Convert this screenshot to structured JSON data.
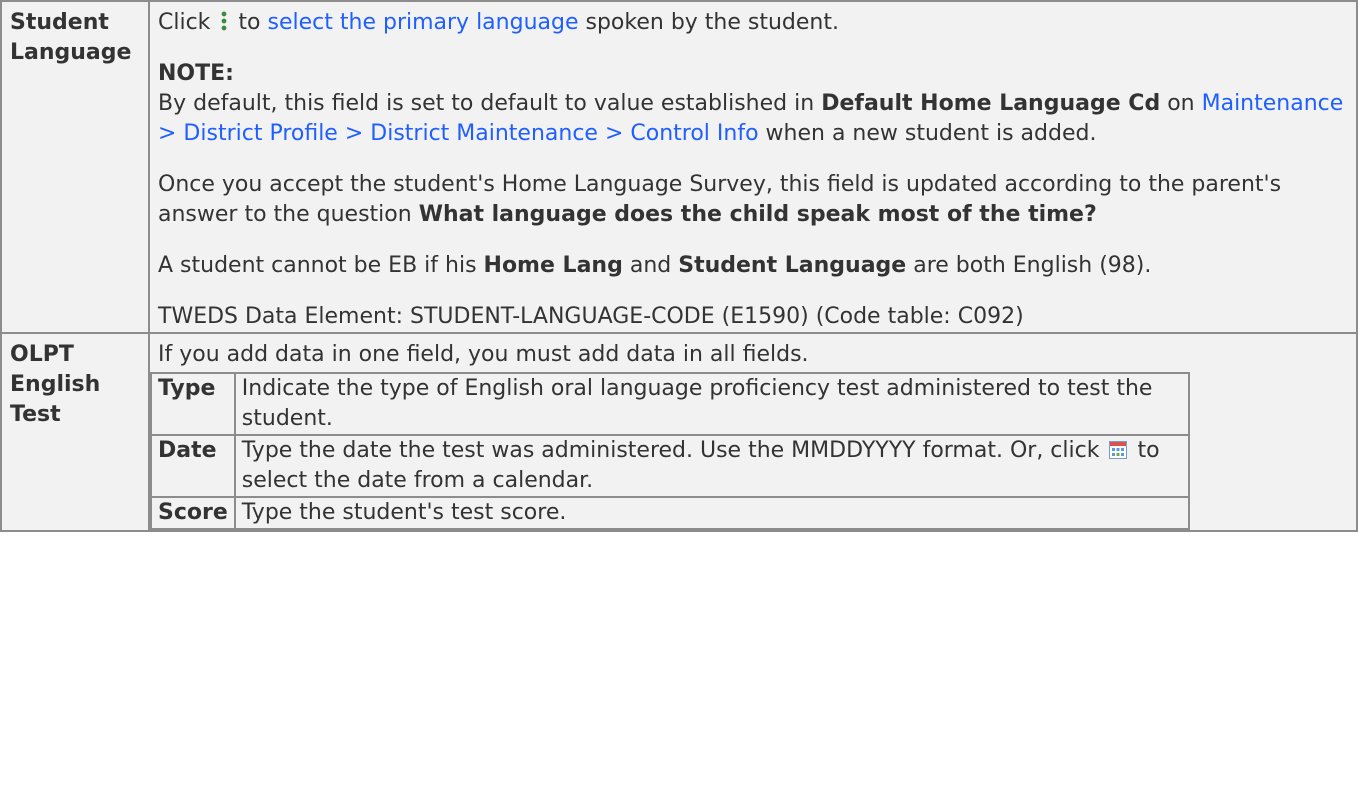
{
  "rows": [
    {
      "label": "Student Language",
      "line1": {
        "pre": "Click",
        "icon": "kebab-menu-icon",
        "mid": "to",
        "link": "select the primary language",
        "post": "spoken by the student."
      },
      "note_heading": "NOTE:",
      "note": {
        "t1": "By default, this field is set to default to value established in",
        "bold": "Default Home Language Cd",
        "t2": "on",
        "link": "Maintenance > District Profile > District Maintenance > Control Info",
        "t3": "when a new student is added."
      },
      "survey": {
        "text": "Once you accept the student's Home Language Survey, this field is updated according to the parent's answer to the question",
        "bold": "What language does the child speak most of the time?"
      },
      "eb": {
        "t1": "A student cannot be EB if his",
        "b1": "Home Lang",
        "t2": "and",
        "b2": "Student Language",
        "t3": "are both English (98)."
      },
      "tweds": "TWEDS Data Element: STUDENT-LANGUAGE-CODE (E1590) (Code table: C092)"
    },
    {
      "label": "OLPT English Test",
      "intro": "If you add data in one field, you must add data in all fields.",
      "subrows": [
        {
          "label": "Type",
          "text": "Indicate the type of English oral language proficiency test administered to test the student."
        },
        {
          "label": "Date",
          "text_pre": "Type the date the test was administered. Use the MMDDYYYY format. Or, click",
          "icon": "calendar-icon",
          "text_post": "to select the date from a calendar."
        },
        {
          "label": "Score",
          "text": "Type the student's test score."
        }
      ]
    }
  ]
}
